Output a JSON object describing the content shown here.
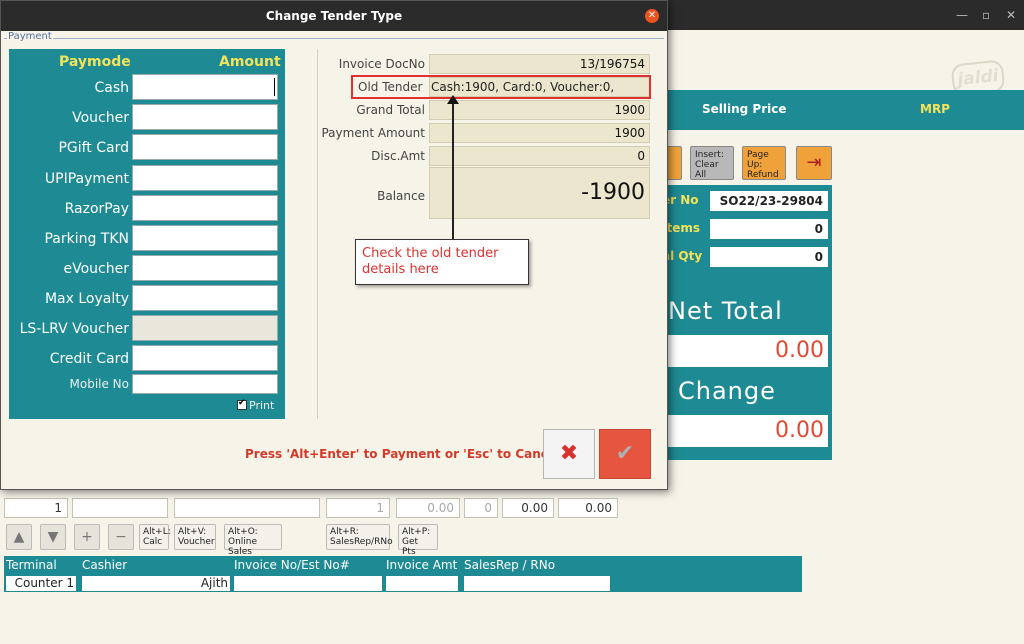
{
  "dialog": {
    "title": "Change Tender Type",
    "close_glyph": "✕",
    "group_label": "Payment",
    "paymode_header": "Paymode",
    "amount_header": "Amount",
    "paymodes": [
      "Cash",
      "Voucher",
      "PGift Card",
      "UPIPayment",
      "RazorPay",
      "Parking TKN",
      "eVoucher",
      "Max Loyalty",
      "LS-LRV Voucher",
      "Credit Card"
    ],
    "mobile_label": "Mobile No",
    "print_label": "Print",
    "info": {
      "invoice_docno_label": "Invoice DocNo",
      "invoice_docno": "13/196754",
      "old_tender_label": "Old Tender",
      "old_tender": "Cash:1900, Card:0, Voucher:0,",
      "grand_total_label": "Grand Total",
      "grand_total": "1900",
      "payment_amount_label": "Payment Amount",
      "payment_amount": "1900",
      "disc_amt_label": "Disc.Amt",
      "disc_amt": "0",
      "balance_label": "Balance",
      "balance": "-1900"
    },
    "callout": "Check the old tender details here",
    "hint": "Press 'Alt+Enter' to Payment or 'Esc' to Cancel",
    "cancel_glyph": "✖",
    "ok_glyph": "✔"
  },
  "background": {
    "logo": "jaldi",
    "window_controls": [
      "—",
      "▫",
      "✕"
    ],
    "header": {
      "selling_price": "Selling Price",
      "mrp": "MRP"
    },
    "buttons": {
      "insert": "Insert: Clear All",
      "pageup": "Page Up: Refund",
      "exit_icon": "⇥"
    },
    "order_no_label": "er No",
    "order_no": "SO22/23-29804",
    "items_label": "Items",
    "items": "0",
    "qty_label": "al Qty",
    "qty": "0",
    "net_total_label": "Net Total",
    "net_total": "0.00",
    "change_label": "Change",
    "change": "0.00",
    "row_values": [
      "1",
      "",
      "",
      "1",
      "0.00",
      "0",
      "0.00",
      "0.00"
    ],
    "tool_buttons": [
      "Alt+L: Calc",
      "Alt+V: Voucher",
      "Alt+O: Online Sales",
      "Alt+R: SalesRep/RNo",
      "Alt+P: Get Pts"
    ],
    "arrow_buttons": [
      "▲",
      "▼",
      "+",
      "−"
    ],
    "footer": {
      "terminal_label": "Terminal",
      "cashier_label": "Cashier",
      "invoice_label": "Invoice No/Est No#",
      "invoice_amt_label": "Invoice Amt",
      "salesrep_label": "SalesRep / RNo",
      "terminal": "Counter 1",
      "cashier": "Ajith"
    }
  }
}
